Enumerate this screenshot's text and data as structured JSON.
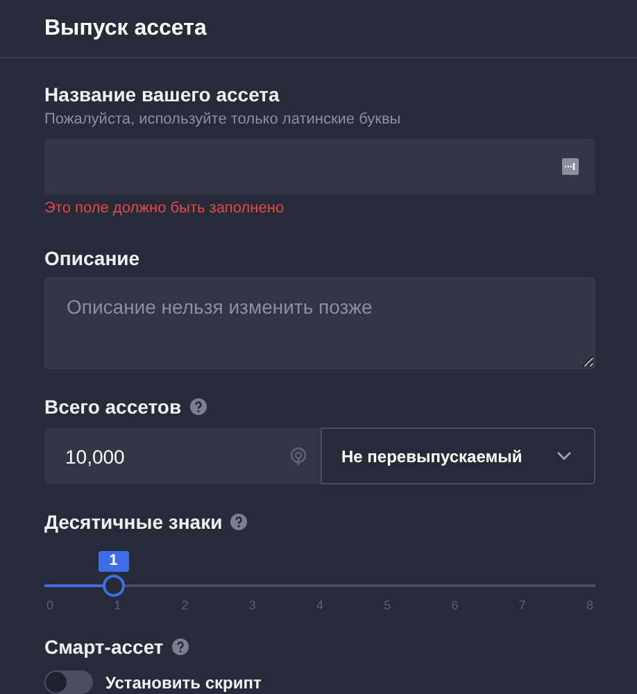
{
  "title": "Выпуск ассета",
  "name_field": {
    "label": "Название вашего ассета",
    "hint": "Пожалуйста, используйте только латинские буквы",
    "error": "Это поле должно быть заполнено"
  },
  "description": {
    "label": "Описание",
    "placeholder": "Описание нельзя изменить позже"
  },
  "total": {
    "label": "Всего ассетов",
    "value": "10,000",
    "reissue": "Не перевыпускаемый"
  },
  "decimals": {
    "label": "Десятичные знаки",
    "bubble": "1",
    "level": 0.125,
    "ticks": [
      "0",
      "1",
      "2",
      "3",
      "4",
      "5",
      "6",
      "7",
      "8"
    ]
  },
  "smart": {
    "label": "Смарт-ассет",
    "toggle": {
      "label": "Установить скрипт",
      "on": false
    }
  }
}
